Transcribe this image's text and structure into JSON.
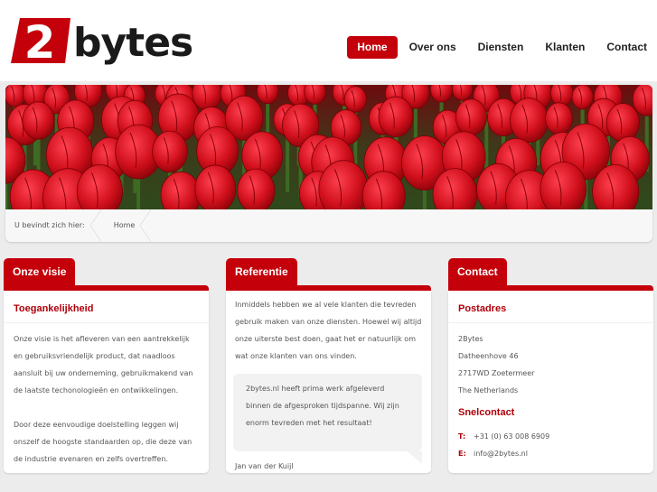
{
  "logo": {
    "mark": "2",
    "text": "bytes"
  },
  "nav": [
    {
      "label": "Home",
      "active": true
    },
    {
      "label": "Over ons",
      "active": false
    },
    {
      "label": "Diensten",
      "active": false
    },
    {
      "label": "Klanten",
      "active": false
    },
    {
      "label": "Contact",
      "active": false
    }
  ],
  "breadcrumb": {
    "prefix": "U bevindt zich hier:",
    "items": [
      "Home"
    ]
  },
  "visie": {
    "tab": "Onze visie",
    "heading": "Toegankelijkheid",
    "paragraph1": "Onze visie is het afleveren van een aantrekkelijk en gebruiksvriendelijk product, dat naadloos aansluit bij uw onderneming, gebruikmakend van de laatste techonologieën en ontwikkelingen.",
    "paragraph2": "Door deze eenvoudige doelstelling leggen wij onszelf de hoogste standaarden op, die deze van de industrie evenaren en zelfs overtreffen."
  },
  "referentie": {
    "tab": "Referentie",
    "intro": "Inmiddels hebben we al vele klanten die tevreden gebruik maken van onze diensten. Hoewel wij altijd onze uiterste best doen, gaat het er natuurlijk om wat onze klanten van ons vinden.",
    "quote": "2bytes.nl heeft prima werk afgeleverd binnen de afgesproken tijdspanne. Wij zijn enorm tevreden met het resultaat!",
    "author": "Jan van der Kuijl"
  },
  "contact": {
    "tab": "Contact",
    "postadres_heading": "Postadres",
    "address": [
      "2Bytes",
      "Datheenhove 46",
      "2717WD Zoetermeer",
      "The Netherlands"
    ],
    "snelcontact_heading": "Snelcontact",
    "phone_label": "T:",
    "phone": "+31 (0) 63 008 6909",
    "email_label": "E:",
    "email": "info@2bytes.nl"
  },
  "colors": {
    "brand_red": "#c4000a",
    "heading_red": "#b0000a"
  }
}
